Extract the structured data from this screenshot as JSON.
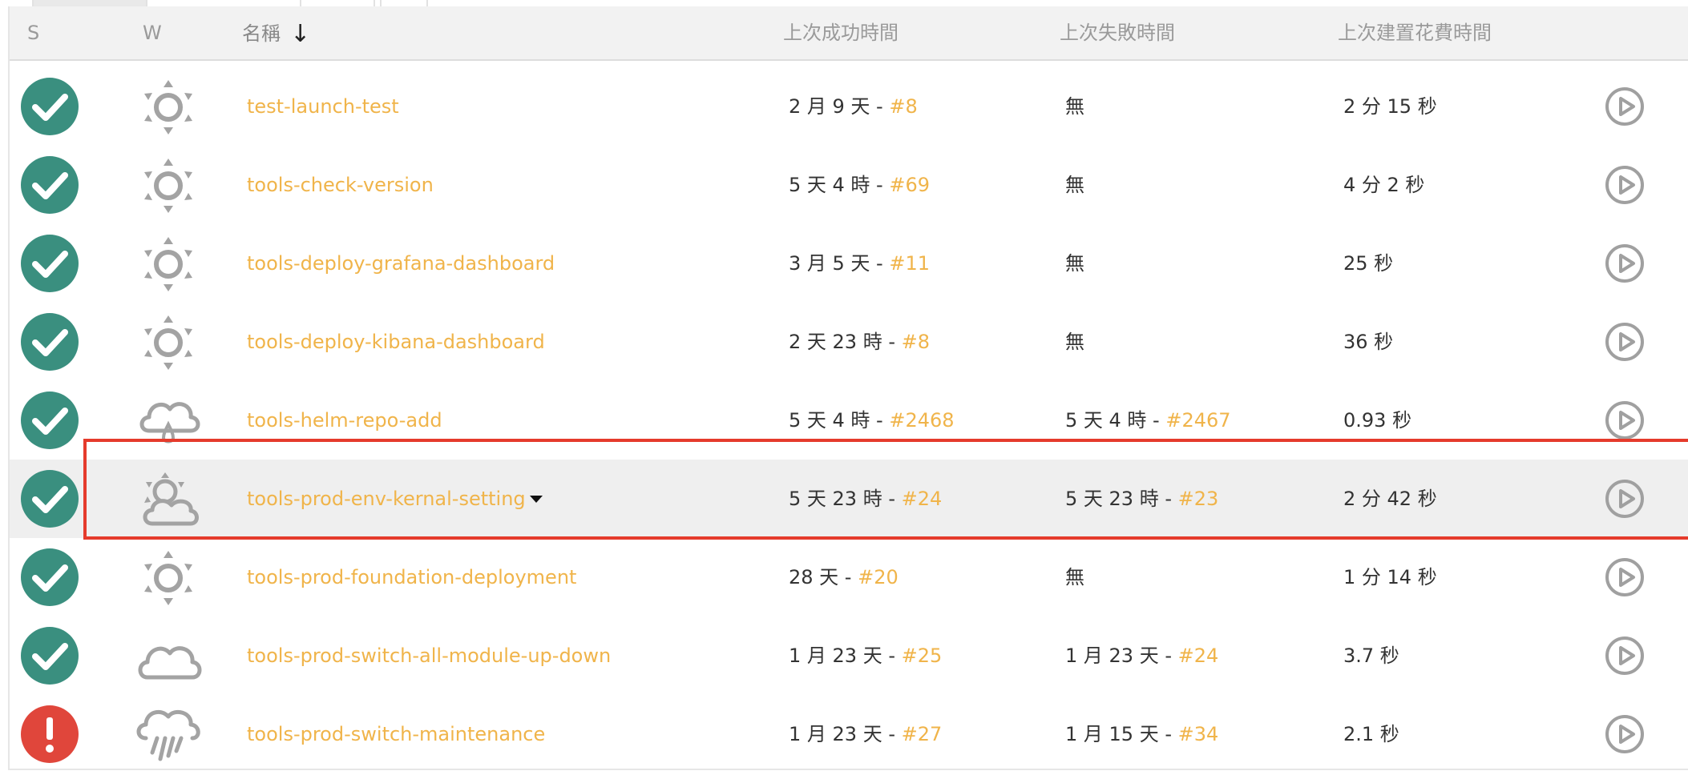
{
  "header": {
    "status_col": "S",
    "weather_col": "W",
    "name_col": "名稱",
    "sort_indicator": "↓",
    "last_success_col": "上次成功時間",
    "last_failure_col": "上次失敗時間",
    "last_duration_col": "上次建置花費時間"
  },
  "colors": {
    "link": "#f0b44a",
    "status_ok": "#3a8f7f",
    "status_fail": "#e0463b",
    "highlight_border": "#e53b2c"
  },
  "jobs": [
    {
      "status": "success",
      "status_icon": "check-icon",
      "weather": "sunny-icon",
      "name": "test-launch-test",
      "last_success_text": "2 月 9 天 - ",
      "last_success_build": "#8",
      "last_failure_text": "無",
      "last_failure_build": "",
      "duration": "2 分 15 秒"
    },
    {
      "status": "success",
      "status_icon": "check-icon",
      "weather": "sunny-icon",
      "name": "tools-check-version",
      "last_success_text": "5 天 4 時 - ",
      "last_success_build": "#69",
      "last_failure_text": "無",
      "last_failure_build": "",
      "duration": "4 分 2 秒"
    },
    {
      "status": "success",
      "status_icon": "check-icon",
      "weather": "sunny-icon",
      "name": "tools-deploy-grafana-dashboard",
      "last_success_text": "3 月 5 天 - ",
      "last_success_build": "#11",
      "last_failure_text": "無",
      "last_failure_build": "",
      "duration": "25 秒"
    },
    {
      "status": "success",
      "status_icon": "check-icon",
      "weather": "sunny-icon",
      "name": "tools-deploy-kibana-dashboard",
      "last_success_text": "2 天 23 時 - ",
      "last_success_build": "#8",
      "last_failure_text": "無",
      "last_failure_build": "",
      "duration": "36 秒"
    },
    {
      "status": "success",
      "status_icon": "check-icon",
      "weather": "cloud-drizzle-icon",
      "name": "tools-helm-repo-add",
      "last_success_text": "5 天 4 時 - ",
      "last_success_build": "#2468",
      "last_failure_text": "5 天 4 時 - ",
      "last_failure_build": "#2467",
      "duration": "0.93 秒"
    },
    {
      "status": "success",
      "status_icon": "check-icon",
      "weather": "partly-cloudy-icon",
      "name": "tools-prod-env-kernal-setting",
      "last_success_text": "5 天 23 時 - ",
      "last_success_build": "#24",
      "last_failure_text": "5 天 23 時 - ",
      "last_failure_build": "#23",
      "duration": "2 分 42 秒"
    },
    {
      "status": "success",
      "status_icon": "check-icon",
      "weather": "sunny-icon",
      "name": "tools-prod-foundation-deployment",
      "last_success_text": "28 天 - ",
      "last_success_build": "#20",
      "last_failure_text": "無",
      "last_failure_build": "",
      "duration": "1 分 14 秒"
    },
    {
      "status": "success",
      "status_icon": "check-icon",
      "weather": "cloudy-icon",
      "name": "tools-prod-switch-all-module-up-down",
      "last_success_text": "1 月 23 天 - ",
      "last_success_build": "#25",
      "last_failure_text": "1 月 23 天 - ",
      "last_failure_build": "#24",
      "duration": "3.7 秒"
    },
    {
      "status": "failure",
      "status_icon": "exclamation-icon",
      "weather": "rain-icon",
      "name": "tools-prod-switch-maintenance",
      "last_success_text": "1 月 23 天 - ",
      "last_success_build": "#27",
      "last_failure_text": "1 月 15 天 - ",
      "last_failure_build": "#34",
      "duration": "2.1 秒"
    }
  ]
}
